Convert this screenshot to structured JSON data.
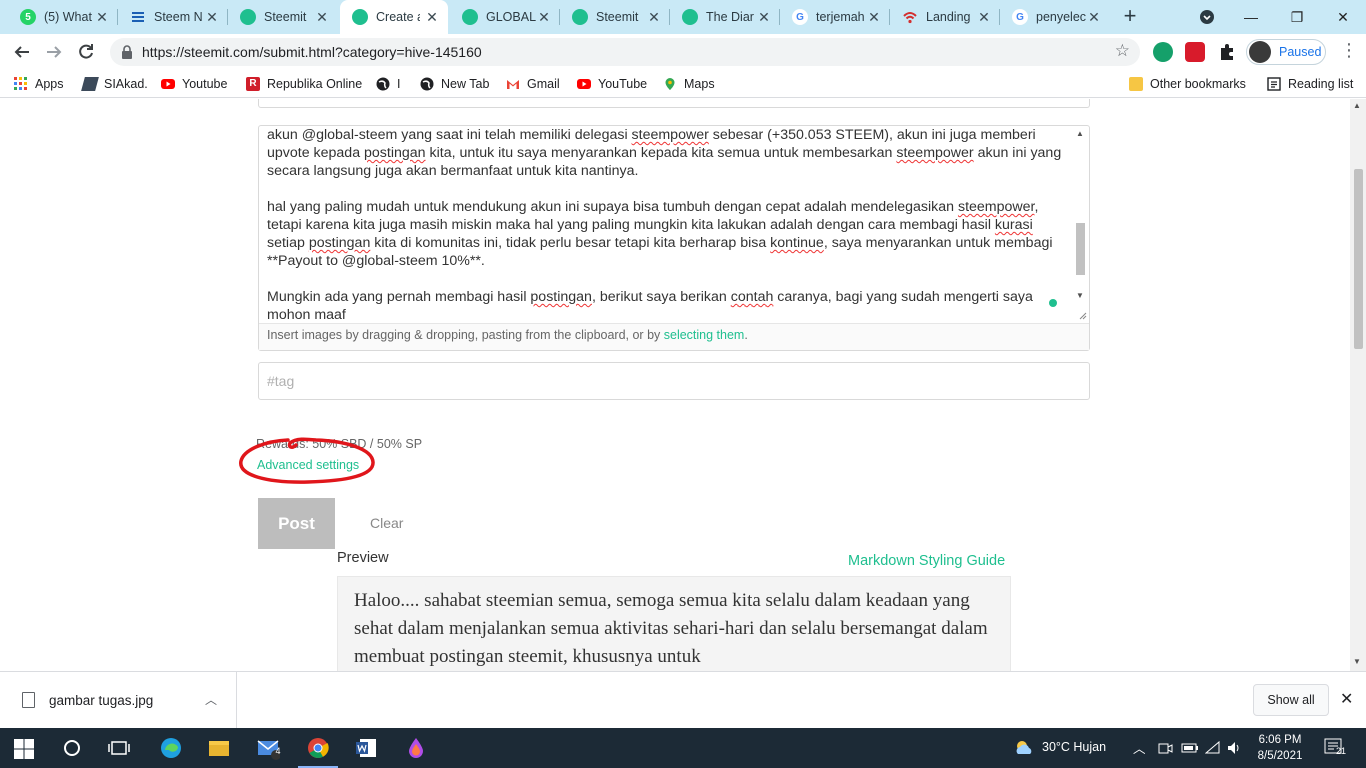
{
  "tabs": [
    {
      "label": "(5) What",
      "icon": "whatsapp-icon",
      "color": "#25d366"
    },
    {
      "label": "Steem N",
      "icon": "steem-news-icon",
      "color": "#1a5fb4"
    },
    {
      "label": "Steemit",
      "icon": "steemit-icon",
      "color": "#1fbf8f"
    },
    {
      "label": "Create a",
      "icon": "steemit-icon",
      "color": "#1fbf8f",
      "active": true
    },
    {
      "label": "GLOBAL",
      "icon": "steemit-icon",
      "color": "#1fbf8f"
    },
    {
      "label": "Steemit",
      "icon": "steemit-icon",
      "color": "#1fbf8f"
    },
    {
      "label": "The Diar",
      "icon": "steemit-icon",
      "color": "#1fbf8f"
    },
    {
      "label": "terjemah",
      "icon": "google-icon",
      "color": "#4285f4"
    },
    {
      "label": "Landing",
      "icon": "wifi-icon",
      "color": "#d32f2f"
    },
    {
      "label": "penyelec",
      "icon": "google-icon",
      "color": "#4285f4"
    }
  ],
  "toolbar": {
    "url": "https://steemit.com/submit.html?category=hive-145160",
    "profile_status": "Paused"
  },
  "bookmarks": [
    {
      "label": "Apps",
      "icon": "apps-grid-icon"
    },
    {
      "label": "SIAkad.",
      "icon": "siakad-icon"
    },
    {
      "label": "Youtube",
      "icon": "youtube-icon"
    },
    {
      "label": "Republika Online",
      "icon": "republika-icon"
    },
    {
      "label": "I",
      "icon": "globe-icon"
    },
    {
      "label": "New Tab",
      "icon": "globe-icon"
    },
    {
      "label": "Gmail",
      "icon": "gmail-icon"
    },
    {
      "label": "YouTube",
      "icon": "youtube-icon"
    },
    {
      "label": "Maps",
      "icon": "maps-pin-icon"
    }
  ],
  "bookmarks_right": {
    "other": "Other bookmarks",
    "reading": "Reading list"
  },
  "editor": {
    "p1_a": "akun @global-steem yang saat ini telah memiliki delegasi ",
    "p1_b": "steempower",
    "p1_c": " sebesar (+350.053 STEEM), akun ini juga memberi upvote kepada ",
    "p1_d": "postingan",
    "p1_e": " kita, untuk itu saya menyarankan kepada kita semua untuk membesarkan ",
    "p1_f": "steempower",
    "p1_g": " akun ini yang secara langsung juga akan bermanfaat untuk kita nantinya.",
    "p2_a": "hal yang paling mudah untuk mendukung akun ini supaya bisa tumbuh dengan cepat adalah mendelegasikan ",
    "p2_b": "steempower",
    "p2_c": ", tetapi karena kita juga masih miskin maka hal yang paling mungkin kita lakukan adalah dengan cara membagi hasil ",
    "p2_d": "kurasi",
    "p2_e": " setiap ",
    "p2_f": "postingan",
    "p2_g": " kita di komunitas ini, tidak perlu besar tetapi kita berharap bisa ",
    "p2_h": "kontinue",
    "p2_i": ", saya menyarankan untuk membagi **Payout to @global-steem 10%**.",
    "p3_a": "Mungkin ada yang pernah membagi hasil ",
    "p3_b": "postingan",
    "p3_c": ", berikut saya berikan ",
    "p3_d": "contah",
    "p3_e": " caranya, bagi yang sudah mengerti saya mohon maaf",
    "footer_text": "Insert images by dragging & dropping, pasting from the clipboard, or by ",
    "footer_link": "selecting them",
    "footer_end": "."
  },
  "tags": {
    "placeholder": "#tag"
  },
  "rewards": "Rewards: 50% SBD / 50% SP",
  "advanced_settings": "Advanced settings",
  "post_button": "Post",
  "clear_button": "Clear",
  "preview": {
    "label": "Preview",
    "guide": "Markdown Styling Guide",
    "text": "Haloo.... sahabat steemian semua, semoga semua kita selalu dalam keadaan yang sehat dalam menjalankan semua aktivitas sehari-hari dan selalu bersemangat dalam membuat postingan steemit, khususnya untuk"
  },
  "download": {
    "filename": "gambar tugas.jpg",
    "show_all": "Show all"
  },
  "taskbar": {
    "weather": "30°C  Hujan",
    "time": "6:06 PM",
    "date": "8/5/2021",
    "mail_badge": "4",
    "notif_count": "21"
  },
  "colors": {
    "steemit_green": "#1fbf8f",
    "annotation_red": "#e0161b",
    "tab_strip": "#c9e9f6",
    "taskbar": "#1c2a36"
  }
}
